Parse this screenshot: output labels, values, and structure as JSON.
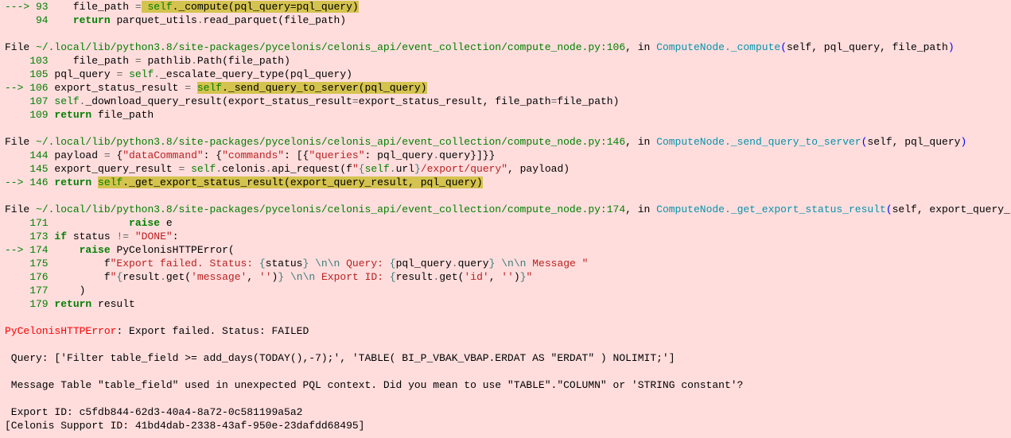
{
  "trace": {
    "f1": {
      "arrow93": "---> 93",
      "code93_a": "    file_path ",
      "code93_op": "=",
      "code93_self": " self",
      "code93_rest": "._compute(pql_query=pql_query)",
      "ln94": "     94",
      "code94_a": "    ",
      "code94_ret": "return",
      "code94_b": " parquet_utils",
      "code94_op1": ".",
      "code94_c": "read_parquet(file_path)"
    },
    "f2": {
      "file": "File ",
      "path": "~/.local/lib/python3.8/site-packages/pycelonis/celonis_api/event_collection/compute_node.py:106",
      "in": ", in ",
      "call": "ComputeNode._compute",
      "sig_open": "(",
      "sig_args": "self, pql_query, file_path",
      "sig_close": ")",
      "ln103": "    103",
      "c103_a": "    file_path ",
      "c103_op": "=",
      "c103_b": " pathlib",
      "c103_dot": ".",
      "c103_c": "Path(file_path)",
      "ln105": "    105",
      "c105_a": " pql_query ",
      "c105_op": "=",
      "c105_b": " ",
      "c105_self": "self",
      "c105_dot": ".",
      "c105_c": "_escalate_query_type(pql_query)",
      "arrow106": "--> 106",
      "c106_a": " export_status_result ",
      "c106_op": "=",
      "c106_sp": " ",
      "c106_self": "self",
      "c106_rest": "._send_query_to_server(pql_query)",
      "ln107": "    107",
      "c107_a": " ",
      "c107_self": "self",
      "c107_dot": ".",
      "c107_b": "_download_query_result(export_status_result",
      "c107_op": "=",
      "c107_c": "export_status_result, file_path",
      "c107_op2": "=",
      "c107_d": "file_path)",
      "ln109": "    109",
      "c109_ret": " return",
      "c109_b": " file_path"
    },
    "f3": {
      "file": "File ",
      "path": "~/.local/lib/python3.8/site-packages/pycelonis/celonis_api/event_collection/compute_node.py:146",
      "in": ", in ",
      "call": "ComputeNode._send_query_to_server",
      "sig_open": "(",
      "sig_args": "self, pql_query",
      "sig_close": ")",
      "ln144": "    144",
      "c144_a": " payload ",
      "c144_op": "=",
      "c144_b": " {",
      "c144_s1": "\"dataCommand\"",
      "c144_c": ": {",
      "c144_s2": "\"commands\"",
      "c144_d": ": [{",
      "c144_s3": "\"queries\"",
      "c144_e": ": pql_query",
      "c144_dot": ".",
      "c144_f": "query}]}}",
      "ln145": "    145",
      "c145_a": " export_query_result ",
      "c145_op": "=",
      "c145_b": " ",
      "c145_self": "self",
      "c145_dot": ".",
      "c145_c": "celonis",
      "c145_dot2": ".",
      "c145_d": "api_request(f",
      "c145_s1": "\"",
      "c145_s2": "{",
      "c145_self2": "self",
      "c145_dot3": ".",
      "c145_u": "url",
      "c145_s3": "}",
      "c145_s4": "/export/query\"",
      "c145_e": ", payload)",
      "arrow146": "--> 146",
      "c146_ret": " return",
      "c146_sp": " ",
      "c146_self": "self",
      "c146_rest": "._get_export_status_result(export_query_result, pql_query)"
    },
    "f4": {
      "file": "File ",
      "path": "~/.local/lib/python3.8/site-packages/pycelonis/celonis_api/event_collection/compute_node.py:174",
      "in": ", in ",
      "call": "ComputeNode._get_export_status_result",
      "sig_open": "(",
      "sig_args": "self, export_query_result, pql_qu",
      "ln171": "    171",
      "c171_a": "             ",
      "c171_raise": "raise",
      "c171_b": " e",
      "ln173": "    173",
      "c173_a": " ",
      "c173_if": "if",
      "c173_b": " status ",
      "c173_op": "!=",
      "c173_sp": " ",
      "c173_s": "\"DONE\"",
      "c173_c": ":",
      "arrow174": "--> 174",
      "c174_a": "     ",
      "c174_raise": "raise",
      "c174_b": " PyCelonisHTTPError(",
      "ln175": "    175",
      "c175_a": "         f",
      "c175_s1": "\"Export failed. Status: ",
      "c175_b1": "{",
      "c175_v1": "status",
      "c175_b2": "}",
      "c175_s2": " ",
      "c175_e1": "\\n\\n",
      "c175_s3": " Query: ",
      "c175_b3": "{",
      "c175_v2": "pql_query",
      "c175_dot": ".",
      "c175_v3": "query",
      "c175_b4": "}",
      "c175_s4": " ",
      "c175_e2": "\\n\\n",
      "c175_s5": " Message \"",
      "ln176": "    176",
      "c176_a": "         f",
      "c176_s1": "\"",
      "c176_b1": "{",
      "c176_v1": "result",
      "c176_dot1": ".",
      "c176_v2": "get(",
      "c176_s2": "'message'",
      "c176_c1": ", ",
      "c176_s3": "''",
      "c176_c2": ")",
      "c176_b2": "}",
      "c176_s4": " ",
      "c176_e1": "\\n\\n",
      "c176_s5": " Export ID: ",
      "c176_b3": "{",
      "c176_v3": "result",
      "c176_dot2": ".",
      "c176_v4": "get(",
      "c176_s6": "'id'",
      "c176_c3": ", ",
      "c176_s7": "''",
      "c176_c4": ")",
      "c176_b4": "}",
      "c176_s8": "\"",
      "ln177": "    177",
      "c177": "     )",
      "ln179": "    179",
      "c179_ret": " return",
      "c179_b": " result"
    },
    "err": {
      "name": "PyCelonisHTTPError",
      "sep": ": Export failed. Status: FAILED",
      "query": " Query: ['Filter table_field >= add_days(TODAY(),-7);', 'TABLE( BI_P_VBAK_VBAP.ERDAT AS \"ERDAT\" ) NOLIMIT;']",
      "message": " Message Table \"table_field\" used in unexpected PQL context. Did you mean to use \"TABLE\".\"COLUMN\" or 'STRING constant'?",
      "exportid": " Export ID: c5fdb844-62d3-40a4-8a72-0c581199a5a2",
      "support": "[Celonis Support ID: 41bd4dab-2338-43af-950e-23dafdd68495]"
    }
  }
}
